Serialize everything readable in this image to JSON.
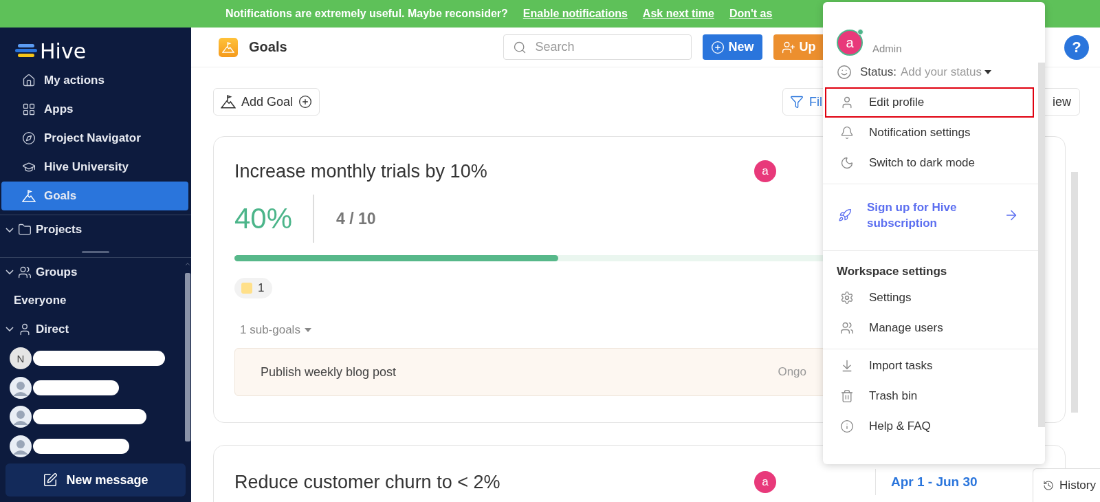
{
  "banner": {
    "message": "Notifications are extremely useful. Maybe reconsider?",
    "links": [
      "Enable notifications",
      "Ask next time",
      "Don't as"
    ]
  },
  "sidebar": {
    "logo": "Hive",
    "nav": [
      {
        "label": "My actions",
        "selected": false
      },
      {
        "label": "Apps",
        "selected": false
      },
      {
        "label": "Project Navigator",
        "selected": false
      },
      {
        "label": "Hive University",
        "selected": false
      },
      {
        "label": "Goals",
        "selected": true
      }
    ],
    "projects": {
      "label": "Projects",
      "expanded": true
    },
    "groups": {
      "label": "Groups",
      "expanded": true,
      "children": [
        "Everyone"
      ]
    },
    "direct": {
      "label": "Direct",
      "expanded": true,
      "contacts": [
        {
          "kind": "initial",
          "initial": "N"
        },
        {
          "kind": "picture"
        },
        {
          "kind": "picture"
        },
        {
          "kind": "picture"
        }
      ]
    },
    "new_message": "New message"
  },
  "header": {
    "title": "Goals",
    "search": {
      "placeholder": "Search"
    },
    "buttons": [
      {
        "kind": "new",
        "label": "New"
      },
      {
        "kind": "upgrade",
        "label": "Up"
      }
    ],
    "help": "?"
  },
  "toolbar": {
    "add_goal": "Add Goal",
    "filter": "Fil",
    "view": "iew"
  },
  "goals": [
    {
      "title": "Increase monthly trials by 10%",
      "owner": "a",
      "percent": "40%",
      "progress": "4 / 10",
      "level": 0.4,
      "tag_count": "1",
      "subgoals_label": "1 sub-goals",
      "subgoals": [
        {
          "title": "Publish weekly blog post",
          "status": "Ongo"
        }
      ]
    },
    {
      "title": "Reduce customer churn to < 2%",
      "owner": "a",
      "dates": "Apr 1 - Jun 30"
    }
  ],
  "menu": {
    "user": {
      "initial": "a",
      "role": "Admin",
      "online": true
    },
    "status_label": "Status:",
    "status_placeholder": "Add your status",
    "sections": [
      {
        "kind": "items",
        "items": [
          {
            "label": "Edit profile",
            "highlighted": true
          },
          {
            "label": "Notification settings",
            "highlighted": false
          },
          {
            "label": "Switch to dark mode",
            "highlighted": false
          }
        ]
      },
      {
        "kind": "promo",
        "label": "Sign up for Hive subscription"
      },
      {
        "kind": "items",
        "heading": "Workspace settings",
        "items": [
          {
            "label": "Settings",
            "highlighted": false
          },
          {
            "label": "Manage users",
            "highlighted": false
          }
        ]
      },
      {
        "kind": "items",
        "items": [
          {
            "label": "Import tasks",
            "highlighted": false
          },
          {
            "label": "Trash bin",
            "highlighted": false
          },
          {
            "label": "Help & FAQ",
            "highlighted": false
          }
        ]
      }
    ]
  },
  "history": "History"
}
